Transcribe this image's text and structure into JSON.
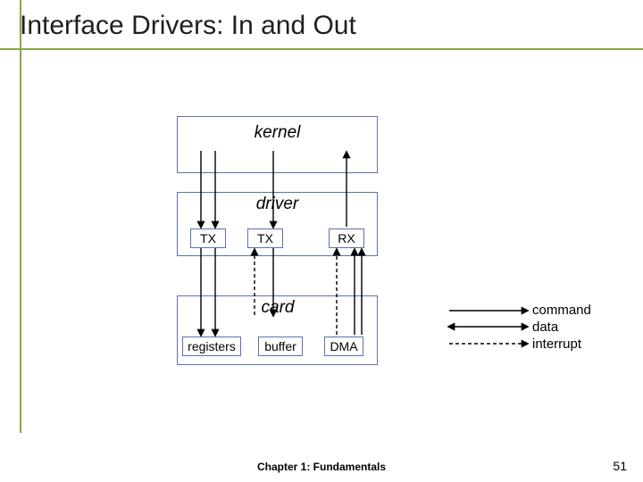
{
  "title": "Interface Drivers: In and Out",
  "boxes": {
    "kernel": "kernel",
    "driver": "driver",
    "tx1": "TX",
    "tx2": "TX",
    "rx": "RX",
    "card": "card",
    "registers": "registers",
    "buffer": "buffer",
    "dma": "DMA"
  },
  "legend": {
    "command": "command",
    "data": "data",
    "interrupt": "interrupt"
  },
  "footer": "Chapter 1: Fundamentals",
  "page": "51"
}
